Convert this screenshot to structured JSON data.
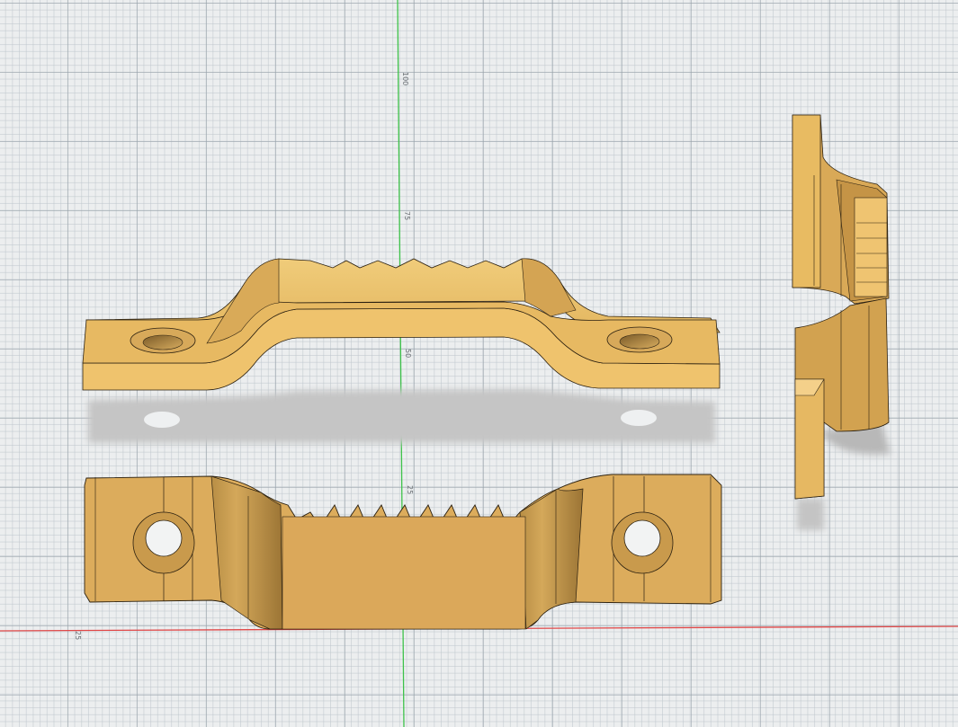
{
  "viewport": {
    "axis_colors": {
      "y_axis": "#3ec24a",
      "x_axis": "#e04848"
    },
    "ruler_labels": {
      "a": "100",
      "b": "75",
      "c": "50",
      "d": "25",
      "e": "25"
    },
    "model_color": "#e8bb62",
    "model_shadow": "#c9c9c9"
  }
}
